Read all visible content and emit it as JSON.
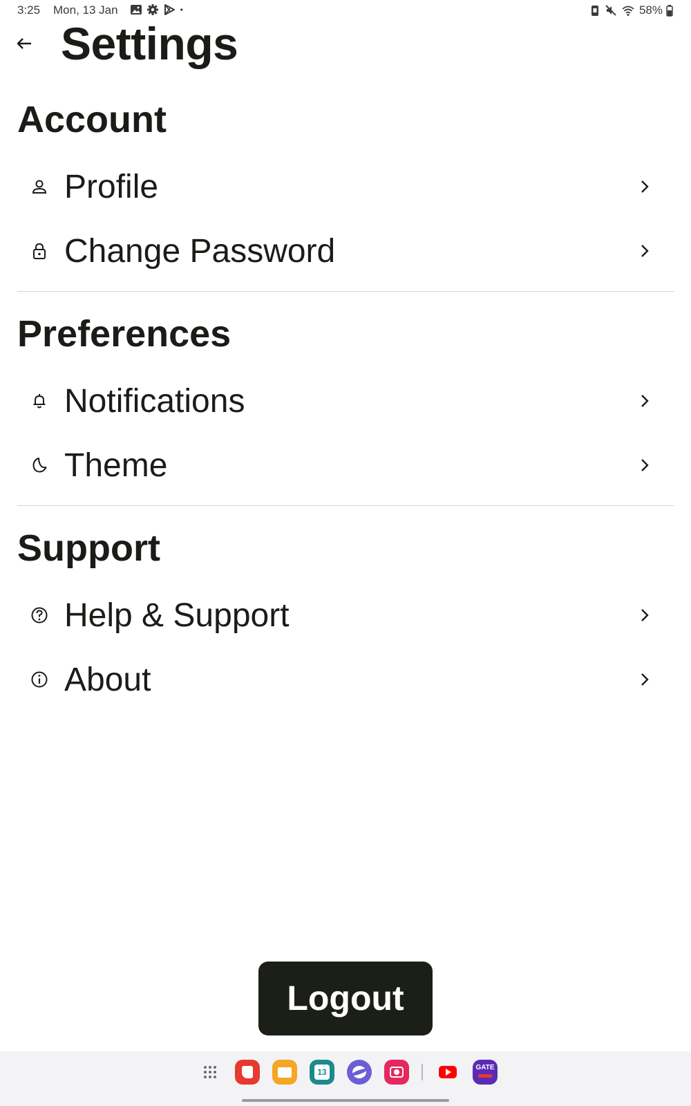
{
  "status_bar": {
    "time": "3:25",
    "date": "Mon, 13 Jan",
    "battery": "58%",
    "left_icons": [
      "gallery-icon",
      "settings-gear-icon",
      "play-store-icon",
      "dot-icon"
    ],
    "right_icons": [
      "battery-saver-icon",
      "mute-icon",
      "wifi-icon",
      "battery-icon"
    ]
  },
  "header": {
    "back_icon": "arrow-left-icon",
    "title": "Settings"
  },
  "sections": [
    {
      "title": "Account",
      "items": [
        {
          "label": "Profile",
          "icon": "person-icon"
        },
        {
          "label": "Change Password",
          "icon": "lock-icon"
        }
      ]
    },
    {
      "title": "Preferences",
      "items": [
        {
          "label": "Notifications",
          "icon": "bell-icon"
        },
        {
          "label": "Theme",
          "icon": "moon-icon"
        }
      ]
    },
    {
      "title": "Support",
      "items": [
        {
          "label": "Help & Support",
          "icon": "help-circle-icon"
        },
        {
          "label": "About",
          "icon": "info-icon"
        }
      ]
    }
  ],
  "logout_label": "Logout",
  "dock": {
    "calendar_day": "13",
    "gate_label": "GATE",
    "apps": [
      "app-drawer-icon",
      "notes-app-icon",
      "files-app-icon",
      "calendar-app-icon",
      "internet-app-icon",
      "camera-app-icon",
      "youtube-app-icon",
      "gate-app-icon"
    ]
  },
  "colors": {
    "text": "#1a1c18",
    "button_bg": "#1b1f18",
    "divider": "#d6d7d2"
  }
}
